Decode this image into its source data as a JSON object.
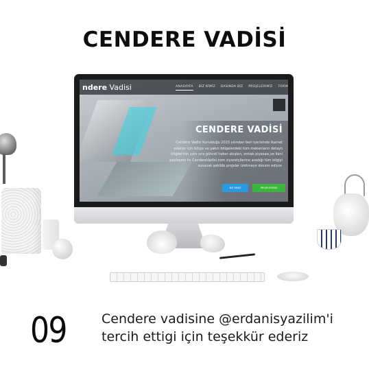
{
  "header": {
    "title": "CENDERE VADİSİ"
  },
  "website": {
    "logo_bold": "ndere",
    "logo_light": " Vadisi",
    "nav": [
      "ANASAYFA",
      "BİZ KİMİZ",
      "BASINDA BİZ",
      "PROJELERİMİZ",
      "FORM"
    ],
    "hero_title": "CENDERE VADİSİ",
    "hero_text": "Cendere Vadisi Kurulduğu 2015 yılından beri içerisinde ikamet ederler için bölge ve yakın bölgelerdeki tüm mekanların detaylı bilgilerinin yanı sıra güncel haber akışları, emlak piyasası,ve ilanl paylaşımı ile CendereVadisi.com ziyaretçilerine aradığı tüm bilgiyi sunacak şekilde projeler üretmeye devam ediyor.",
    "button_primary": "BİZ KİMİZ",
    "button_secondary": "PROJELERİMİZ"
  },
  "caption": {
    "number": "09",
    "line1": "Cendere vadisine @erdanisyazilim'i",
    "line2": "tercih ettigi için teşekkür ederiz"
  },
  "colors": {
    "primary_button": "#2a9ae0",
    "secondary_button": "#3cb53c",
    "accent_cyan": "#33d6e6"
  }
}
